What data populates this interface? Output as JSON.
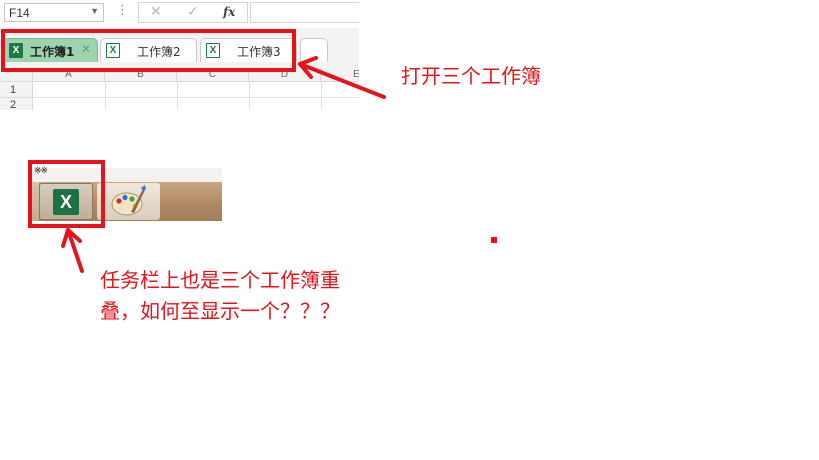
{
  "formula_bar": {
    "name_box": "F14",
    "cancel_icon": "✕",
    "enter_icon": "✓",
    "function_label": "fx",
    "formula_value": ""
  },
  "workbook_tabs": [
    {
      "label": "工作簿1",
      "active": true
    },
    {
      "label": "工作簿2",
      "active": false
    },
    {
      "label": "工作簿3",
      "active": false
    }
  ],
  "grid": {
    "columns": [
      "A",
      "B",
      "C",
      "D",
      "E"
    ],
    "rows": [
      "1",
      "2"
    ]
  },
  "taskbar": {
    "top_text": "※※",
    "excel_button_glyph": "X",
    "apps": [
      "excel-icon",
      "paint-icon"
    ]
  },
  "annotations": {
    "top_note": "打开三个工作簿",
    "bottom_note": "任务栏上也是三个工作簿重叠，如何至显示一个？？？",
    "color": "#e3141c"
  },
  "colors": {
    "active_tab": "#9fd3b0",
    "excel_green": "#1e7145"
  }
}
